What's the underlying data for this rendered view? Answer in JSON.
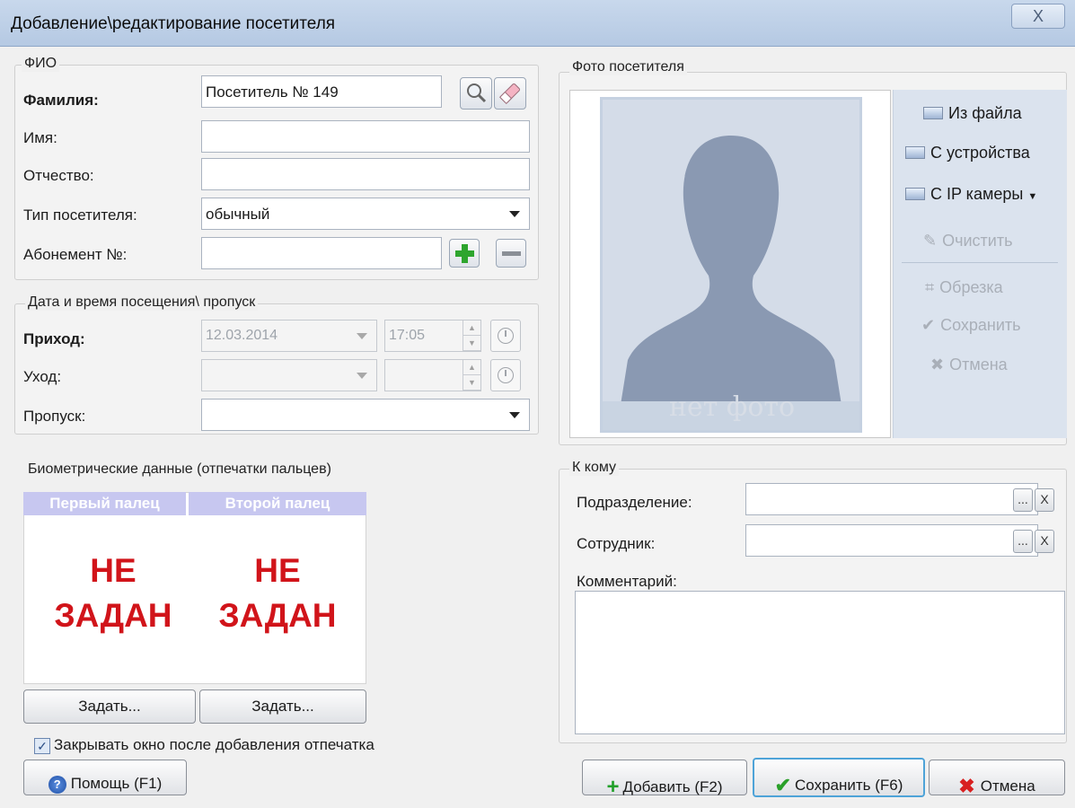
{
  "window": {
    "title": "Добавление\\редактирование посетителя",
    "close": "X"
  },
  "fio": {
    "group_title": "ФИО",
    "surname_label": "Фамилия:",
    "surname_value": "Посетитель № 149",
    "name_label": "Имя:",
    "patronymic_label": "Отчество:",
    "type_label": "Тип посетителя:",
    "type_value": "обычный",
    "subscription_label": "Абонемент №:"
  },
  "visit": {
    "group_title": "Дата и время посещения\\ пропуск",
    "arrival_label": "Приход:",
    "arrival_date": "12.03.2014",
    "arrival_time": "17:05",
    "leave_label": "Уход:",
    "pass_label": "Пропуск:"
  },
  "biometrics": {
    "group_title": "Биометрические данные (отпечатки пальцев)",
    "columns": [
      "Первый палец",
      "Второй палец"
    ],
    "status_line1": "НЕ",
    "status_line2": "ЗАДАН",
    "set_button": "Задать...",
    "close_checkbox_label": "Закрывать окно после добавления отпечатка",
    "close_checkbox_checked": true
  },
  "photo": {
    "group_title": "Фото посетителя",
    "no_photo": "нет фото",
    "tools": {
      "from_file": "Из файла",
      "from_device": "С устройства",
      "from_ip": "С IP камеры",
      "clear": "Очистить",
      "crop": "Обрезка",
      "save": "Сохранить",
      "cancel": "Отмена"
    }
  },
  "whom": {
    "group_title": "К кому",
    "department_label": "Подразделение:",
    "employee_label": "Сотрудник:",
    "comment_label": "Комментарий:",
    "browse": "...",
    "clear": "X"
  },
  "footer": {
    "help": "Помощь (F1)",
    "add": "Добавить (F2)",
    "save": "Сохранить (F6)",
    "cancel": "Отмена"
  }
}
